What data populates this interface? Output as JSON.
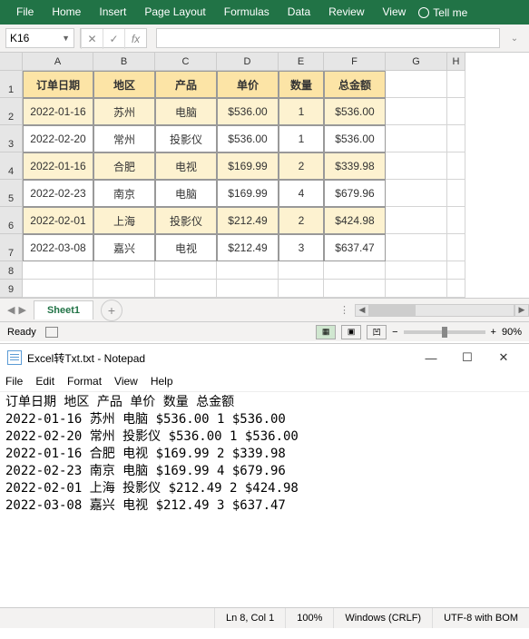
{
  "excel": {
    "ribbon": [
      "File",
      "Home",
      "Insert",
      "Page Layout",
      "Formulas",
      "Data",
      "Review",
      "View"
    ],
    "tell_me": "Tell me",
    "name_box": "K16",
    "fx_label": "fx",
    "columns": [
      "A",
      "B",
      "C",
      "D",
      "E",
      "F",
      "G",
      "H"
    ],
    "row_nums": [
      "1",
      "2",
      "3",
      "4",
      "5",
      "6",
      "7",
      "8",
      "9"
    ],
    "headers": [
      "订单日期",
      "地区",
      "产品",
      "单价",
      "数量",
      "总金额"
    ],
    "rows": [
      {
        "date": "2022-01-16",
        "region": "苏州",
        "product": "电脑",
        "price": "$536.00",
        "qty": "1",
        "total": "$536.00",
        "alt": true
      },
      {
        "date": "2022-02-20",
        "region": "常州",
        "product": "投影仪",
        "price": "$536.00",
        "qty": "1",
        "total": "$536.00",
        "alt": false
      },
      {
        "date": "2022-01-16",
        "region": "合肥",
        "product": "电视",
        "price": "$169.99",
        "qty": "2",
        "total": "$339.98",
        "alt": true
      },
      {
        "date": "2022-02-23",
        "region": "南京",
        "product": "电脑",
        "price": "$169.99",
        "qty": "4",
        "total": "$679.96",
        "alt": false
      },
      {
        "date": "2022-02-01",
        "region": "上海",
        "product": "投影仪",
        "price": "$212.49",
        "qty": "2",
        "total": "$424.98",
        "alt": true
      },
      {
        "date": "2022-03-08",
        "region": "嘉兴",
        "product": "电视",
        "price": "$212.49",
        "qty": "3",
        "total": "$637.47",
        "alt": false
      }
    ],
    "sheet_name": "Sheet1",
    "status_ready": "Ready",
    "zoom": "90%"
  },
  "notepad": {
    "title": "Excel转Txt.txt - Notepad",
    "menu": [
      "File",
      "Edit",
      "Format",
      "View",
      "Help"
    ],
    "content": "订单日期 地区 产品 单价 数量 总金额\n2022-01-16 苏州 电脑 $536.00 1 $536.00\n2022-02-20 常州 投影仪 $536.00 1 $536.00\n2022-01-16 合肥 电视 $169.99 2 $339.98\n2022-02-23 南京 电脑 $169.99 4 $679.96\n2022-02-01 上海 投影仪 $212.49 2 $424.98\n2022-03-08 嘉兴 电视 $212.49 3 $637.47\n",
    "status": {
      "pos": "Ln 8, Col 1",
      "zoom": "100%",
      "eol": "Windows (CRLF)",
      "encoding": "UTF-8 with BOM"
    }
  }
}
